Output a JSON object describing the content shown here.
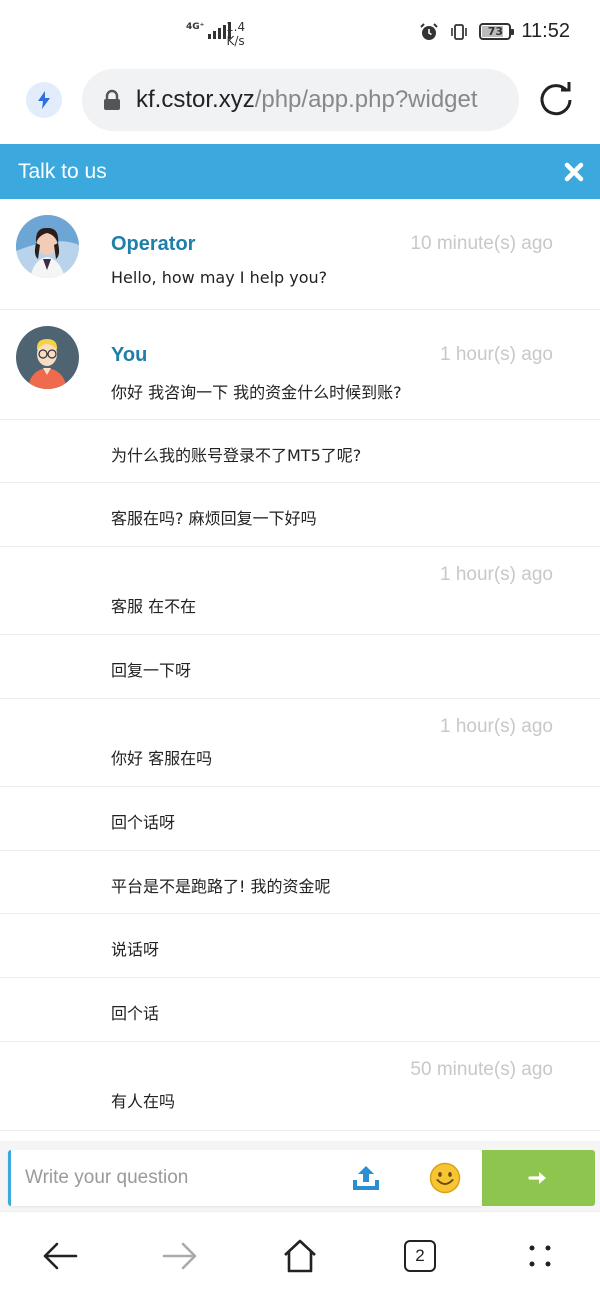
{
  "status_bar": {
    "network": "4G⁺",
    "speed_value": "1.4",
    "speed_unit": "K/s",
    "battery": "73",
    "battery_level": 0.73,
    "time": "11:52"
  },
  "browser": {
    "url_host": "kf.cstor.xyz",
    "url_path": "/php/app.php?widget",
    "tab_count": "2"
  },
  "chat": {
    "title": "Talk to us",
    "input_placeholder": "Write your question",
    "messages": [
      {
        "name": "Operator",
        "time": "10 minute(s) ago",
        "text": "Hello, how may I help you?"
      },
      {
        "name": "You",
        "time": "1 hour(s) ago",
        "text": "你好 我咨询一下 我的资金什么时候到账?"
      },
      {
        "text": "为什么我的账号登录不了MT5了呢?"
      },
      {
        "text": "客服在吗?  麻烦回复一下好吗"
      },
      {
        "time": "1 hour(s) ago",
        "text": "客服 在不在"
      },
      {
        "text": "回复一下呀"
      },
      {
        "time": "1 hour(s) ago",
        "text": "你好 客服在吗"
      },
      {
        "text": "回个话呀"
      },
      {
        "text": "平台是不是跑路了!  我的资金呢"
      },
      {
        "text": "说话呀"
      },
      {
        "text": "回个话"
      },
      {
        "time": "50 minute(s) ago",
        "text": "有人在吗"
      }
    ]
  },
  "icons": {
    "bolt": "bolt-icon",
    "lock": "lock-icon",
    "reload": "reload-icon",
    "close": "close-icon",
    "upload": "upload-icon",
    "emoji": "smiley-icon",
    "send": "arrow-right-icon",
    "back": "arrow-left-icon",
    "forward": "arrow-right-icon",
    "home": "home-icon",
    "menu": "dots-grid-icon"
  },
  "colors": {
    "header": "#3ba9de",
    "name": "#1f7fa9",
    "send": "#8dc54f",
    "time": "#c8c8c8"
  }
}
